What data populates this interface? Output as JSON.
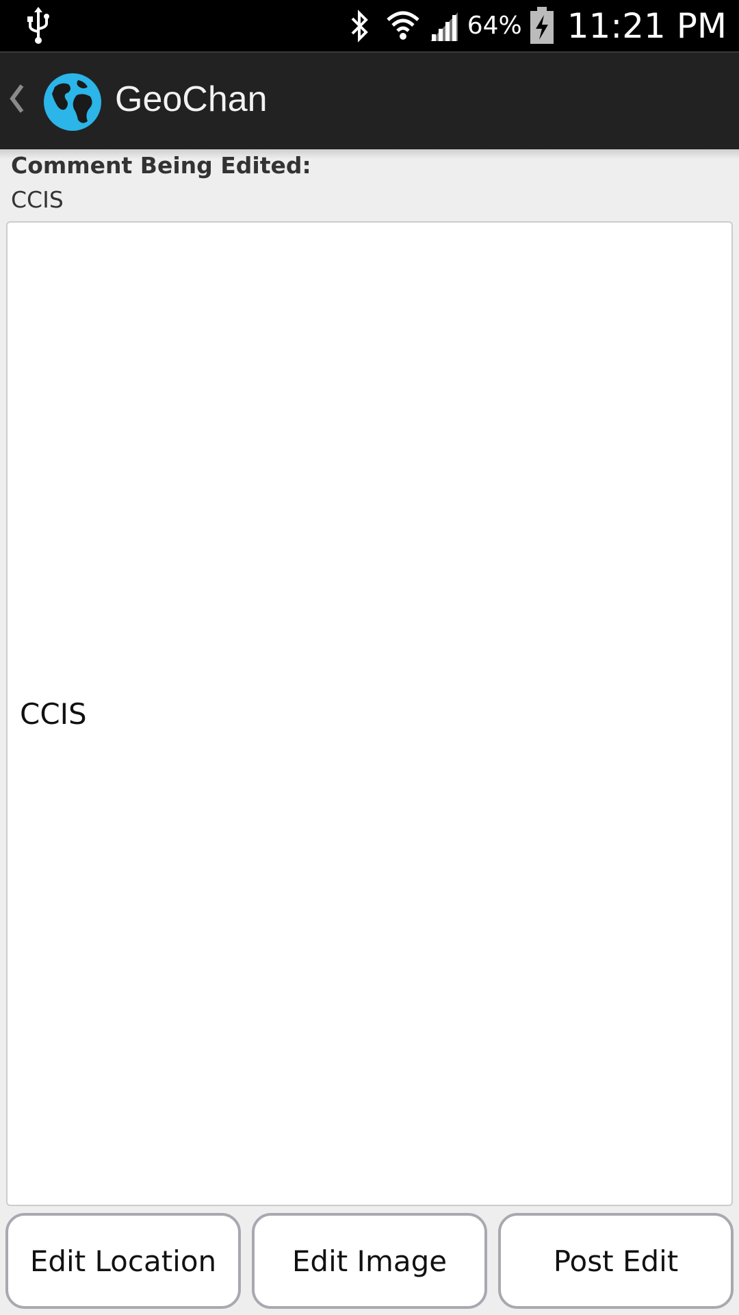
{
  "status_bar": {
    "battery_percent": "64%",
    "time": "11:21 PM",
    "icons": [
      "usb-icon",
      "bluetooth-icon",
      "wifi-icon",
      "signal-icon",
      "battery-charging-icon"
    ]
  },
  "action_bar": {
    "title": "GeoChan",
    "icons": [
      "back-chevron-icon",
      "globe-icon"
    ]
  },
  "edit": {
    "label": "Comment Being Edited:",
    "original_text": "CCIS",
    "comment_value": "CCIS"
  },
  "buttons": {
    "edit_location": "Edit Location",
    "edit_image": "Edit Image",
    "post_edit": "Post Edit"
  },
  "colors": {
    "status_bar_bg": "#000000",
    "action_bar_bg": "#222222",
    "page_bg": "#eeeeee",
    "globe_blue": "#2bb5e8"
  }
}
